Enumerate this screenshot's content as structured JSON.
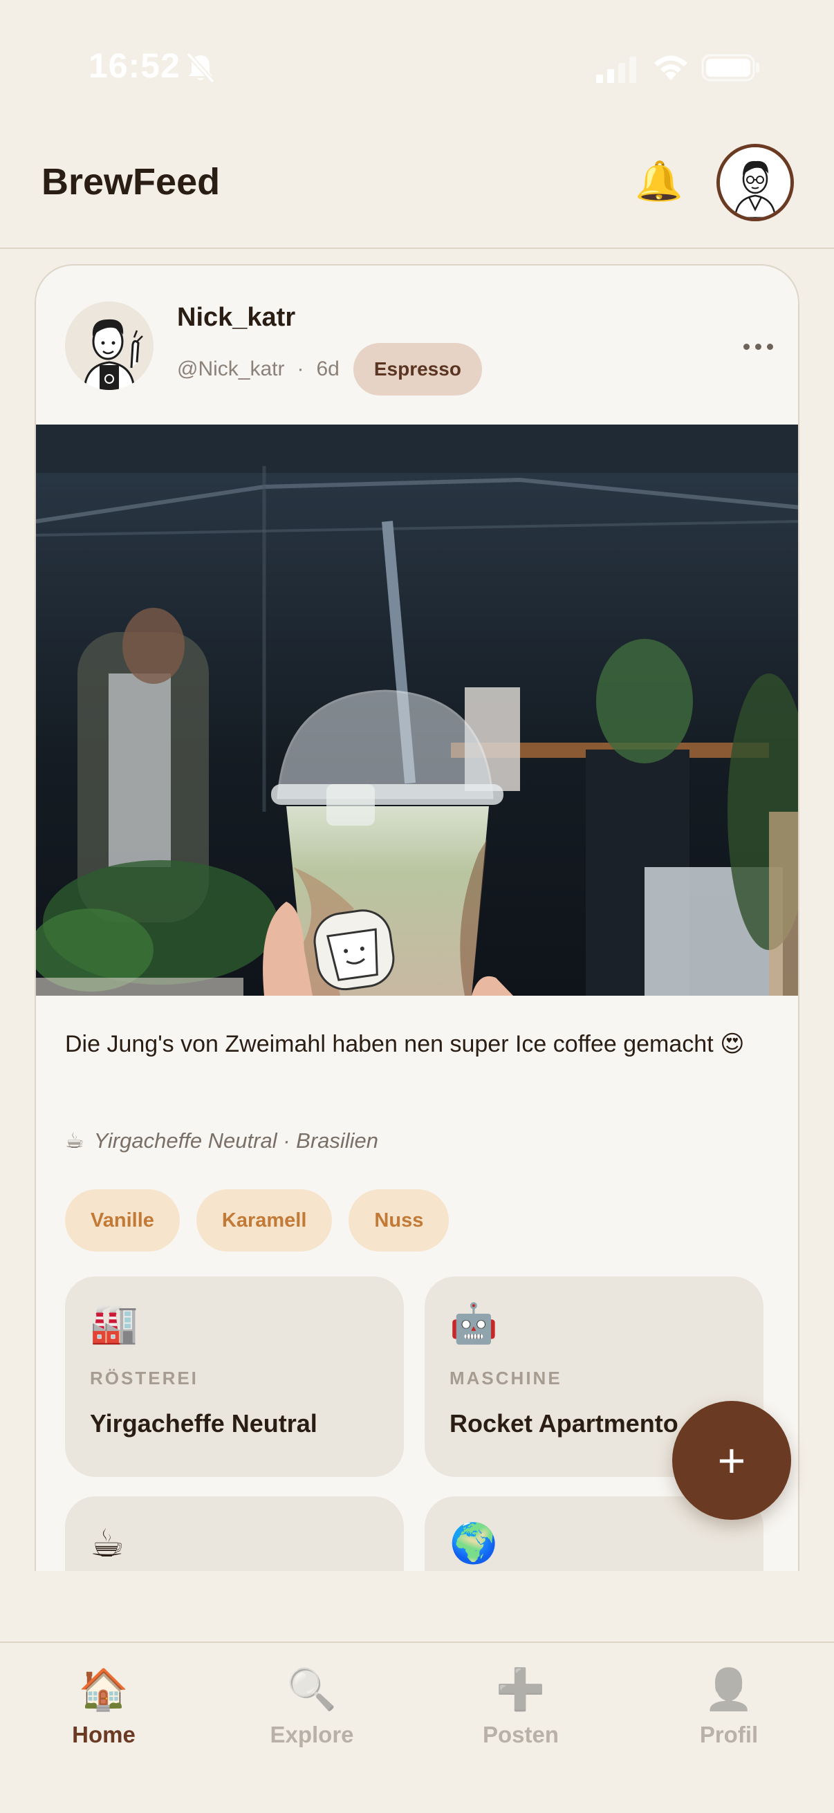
{
  "status_bar": {
    "time": "16:52"
  },
  "header": {
    "title": "BrewFeed"
  },
  "post": {
    "author_name": "Nick_katr",
    "handle": "@Nick_katr",
    "separator": "·",
    "age": "6d",
    "brew_type": "Espresso",
    "caption": "Die Jung's von Zweimahl haben nen super Ice coffee gemacht 😍",
    "bean_icon": "☕",
    "bean_info": "Yirgacheffe Neutral · Brasilien",
    "tags": [
      "Vanille",
      "Karamell",
      "Nuss"
    ],
    "tiles": [
      {
        "icon": "🏭",
        "label": "RÖSTEREI",
        "value": "Yirgacheffe Neutral"
      },
      {
        "icon": "🤖",
        "label": "MASCHINE",
        "value": "Rocket Apartmento"
      },
      {
        "icon": "☕",
        "label": "",
        "value": ""
      },
      {
        "icon": "🌍",
        "label": "",
        "value": ""
      }
    ]
  },
  "fab": {
    "label": "+"
  },
  "nav": [
    {
      "icon": "🏠",
      "label": "Home"
    },
    {
      "icon": "🔍",
      "label": "Explore"
    },
    {
      "icon": "➕",
      "label": "Posten"
    },
    {
      "icon": "👤",
      "label": "Profil"
    }
  ],
  "colors": {
    "background": "#f3efe7",
    "card": "#f8f6f2",
    "accent_brown": "#6b3a22",
    "tag_bg": "#f6e5cc",
    "tag_text": "#c27a36",
    "badge_bg": "#e6d3c6"
  }
}
